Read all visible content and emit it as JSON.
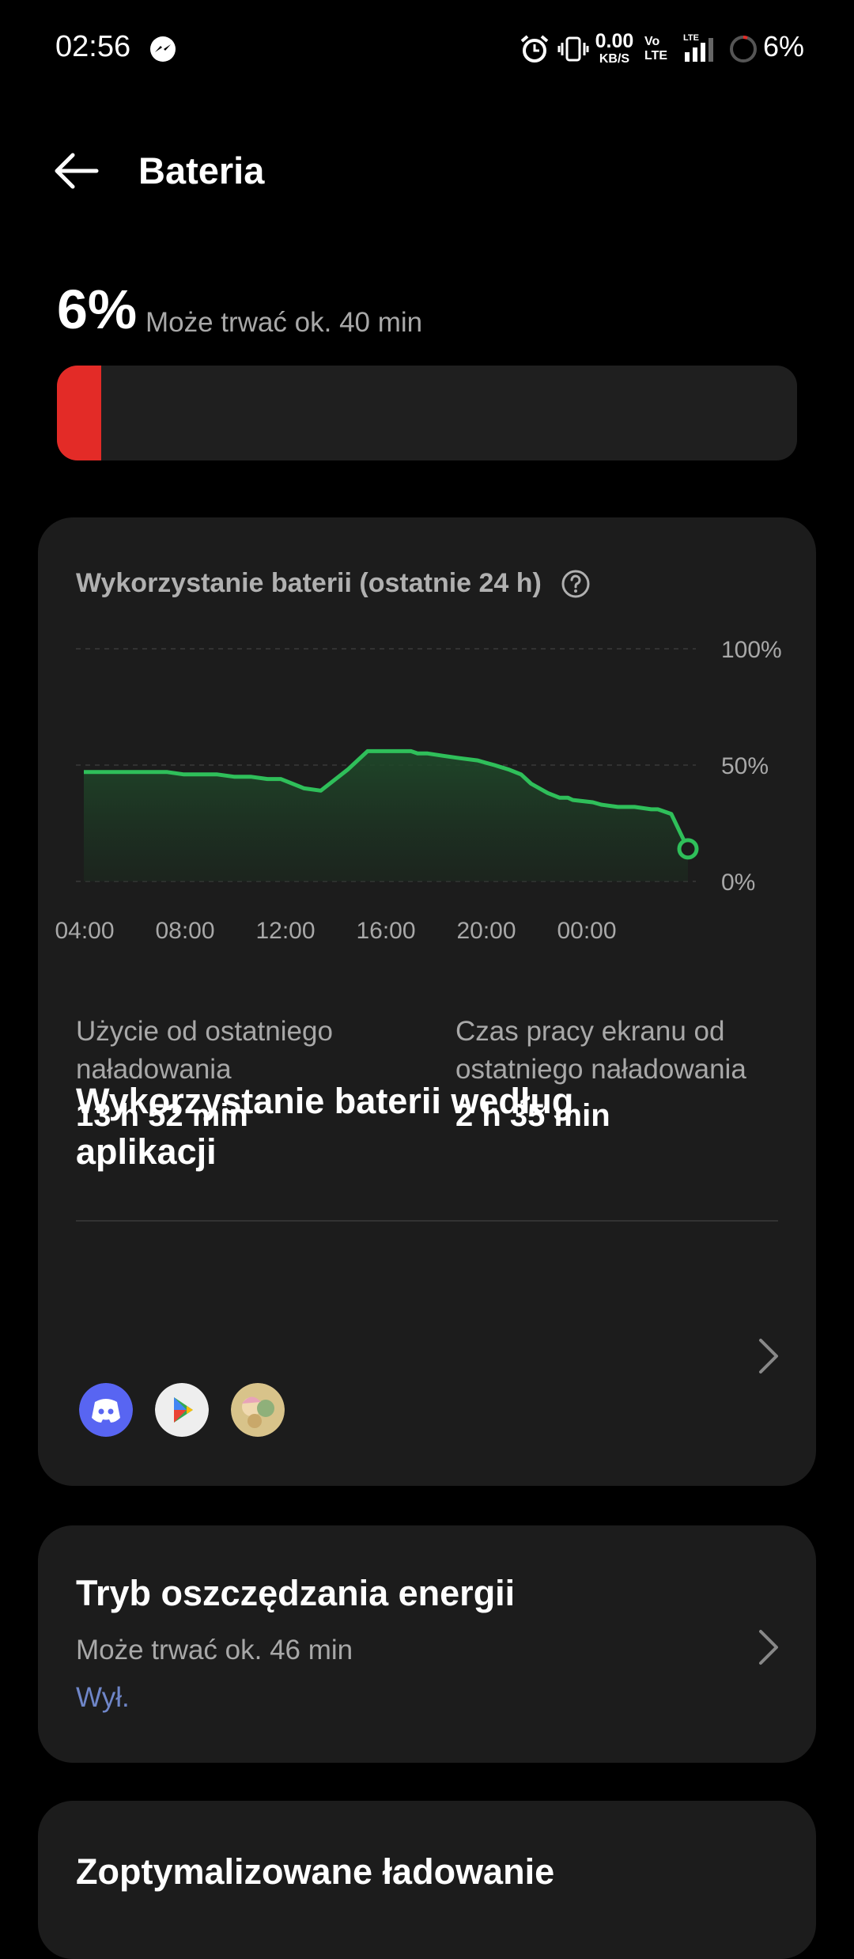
{
  "status_bar": {
    "time": "02:56",
    "net_speed_value": "0.00",
    "net_speed_unit": "KB/S",
    "volte_top": "Vo",
    "volte_bottom": "LTE",
    "network_type": "LTE",
    "battery": "6%",
    "icons": [
      "messenger-icon",
      "alarm-icon",
      "vibrate-icon",
      "signal-icon",
      "battery-ring-icon"
    ]
  },
  "header": {
    "title": "Bateria",
    "back_icon": "arrow-left-icon"
  },
  "battery": {
    "percent": "6%",
    "estimate": "Może trwać ok. 40 min",
    "level_fraction": 0.06,
    "level_color": "#e32b27"
  },
  "usage": {
    "title": "Wykorzystanie baterii (ostatnie 24 h)",
    "help_icon": "question-circle-icon",
    "stats": [
      {
        "label": "Użycie od ostatniego naładowania",
        "value": "13 h 52 min"
      },
      {
        "label": "Czas pracy ekranu od ostatniego naładowania",
        "value": "2 h 35 min"
      }
    ],
    "apps_title": "Wykorzystanie baterii według aplikacji",
    "apps": [
      "discord-icon",
      "play-store-icon",
      "game-avatar-icon"
    ]
  },
  "chart_data": {
    "type": "area",
    "x_ticks": [
      "04:00",
      "08:00",
      "12:00",
      "16:00",
      "20:00",
      "00:00"
    ],
    "y_ticks": [
      "100%",
      "50%",
      "0%"
    ],
    "ylim": [
      0,
      100
    ],
    "xlim": [
      0,
      24
    ],
    "grid": true,
    "line_color": "#2fbf5a",
    "x": [
      0,
      2.5,
      3.5,
      5,
      6,
      7,
      8,
      9,
      10,
      11,
      11.8,
      13.2,
      14.2,
      15.8,
      17,
      18.5,
      19.6,
      20,
      20.6,
      21.5,
      22.5,
      23.6,
      24.1,
      24.6,
      25.5,
      26.2,
      26.8,
      27.8,
      28.5,
      29.0,
      29.3
    ],
    "y": [
      47,
      47,
      47,
      47,
      46,
      46,
      46,
      45,
      45,
      44,
      44,
      40,
      39,
      48,
      56,
      56,
      56,
      55,
      55,
      54,
      53,
      52,
      51,
      50,
      48,
      46,
      42,
      38,
      36,
      36,
      35
    ],
    "x_extended": [
      29.3,
      30.5,
      31.0,
      32.0,
      33.0,
      34.0,
      34.4,
      35.2
    ],
    "y_extended": [
      35,
      34,
      33,
      32,
      32,
      31,
      31,
      29
    ],
    "end_marker": {
      "x": 36.2,
      "y": 14
    }
  },
  "saver": {
    "title": "Tryb oszczędzania energii",
    "estimate": "Może trwać ok. 46 min",
    "status": "Wył."
  },
  "charging": {
    "title": "Zoptymalizowane ładowanie"
  }
}
